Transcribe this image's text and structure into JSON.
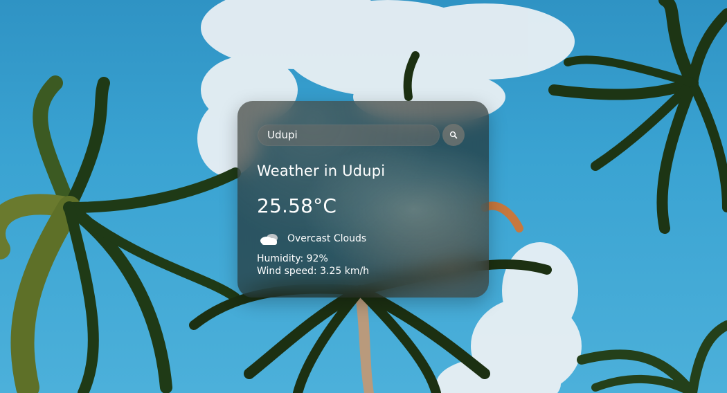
{
  "search": {
    "value": "Udupi",
    "button_icon": "search-icon"
  },
  "weather": {
    "title": "Weather in Udupi",
    "temperature": "25.58°C",
    "icon": "overcast-clouds-icon",
    "description": "Overcast Clouds",
    "humidity": "Humidity: 92%",
    "wind": "Wind speed: 3.25 km/h"
  },
  "colors": {
    "sky": "#3aa3d2",
    "card": "#1e221c",
    "text": "#ffffff"
  }
}
